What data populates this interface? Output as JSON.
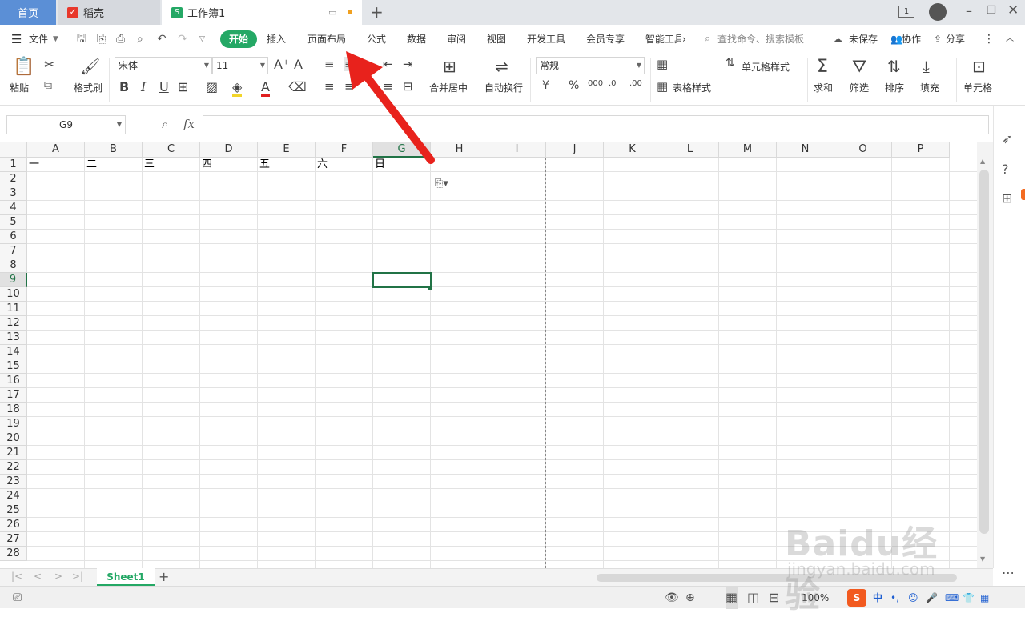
{
  "tabs": {
    "home": "首页",
    "daoke": "稻壳",
    "book": "工作簿1",
    "add": "+"
  },
  "menu": {
    "file": "文件",
    "start": "开始",
    "insert": "插入",
    "layout": "页面布局",
    "formula": "公式",
    "data": "数据",
    "review": "审阅",
    "view": "视图",
    "dev": "开发工具",
    "member": "会员专享",
    "smart": "智能工具",
    "search_placeholder": "查找命令、搜索模板",
    "unsaved": "未保存",
    "collab": "协作",
    "share": "分享"
  },
  "ribbon": {
    "paste": "粘贴",
    "format_brush": "格式刷",
    "font_name": "宋体",
    "font_size": "11",
    "merge_center": "合并居中",
    "wrap_text": "自动换行",
    "number_format": "常规",
    "cell_style": "单元格样式",
    "table_style": "表格样式",
    "sum": "求和",
    "filter": "筛选",
    "sort": "排序",
    "fill": "填充",
    "cell": "单元格"
  },
  "formula_bar": {
    "name_box": "G9",
    "fx": "fx",
    "value": ""
  },
  "columns": [
    "A",
    "B",
    "C",
    "D",
    "E",
    "F",
    "G",
    "H",
    "I",
    "J",
    "K",
    "L",
    "M",
    "N",
    "O",
    "P"
  ],
  "rows": [
    "1",
    "2",
    "3",
    "4",
    "5",
    "6",
    "7",
    "8",
    "9",
    "10",
    "11",
    "12",
    "13",
    "14",
    "15",
    "16",
    "17",
    "18",
    "19",
    "20",
    "21",
    "22",
    "23",
    "24",
    "25",
    "26",
    "27",
    "28"
  ],
  "cells_row1": [
    "一",
    "二",
    "三",
    "四",
    "五",
    "六",
    "日"
  ],
  "selected_cell": "G9",
  "sheets": [
    "Sheet1"
  ],
  "status": {
    "zoom": "100%",
    "ime": "中"
  },
  "watermark": {
    "line1": "Baidu经验",
    "line2": "jingyan.baidu.com"
  },
  "colors": {
    "accent": "#24a865",
    "home_tab": "#5b8fd6",
    "arrow": "#e8221c"
  }
}
